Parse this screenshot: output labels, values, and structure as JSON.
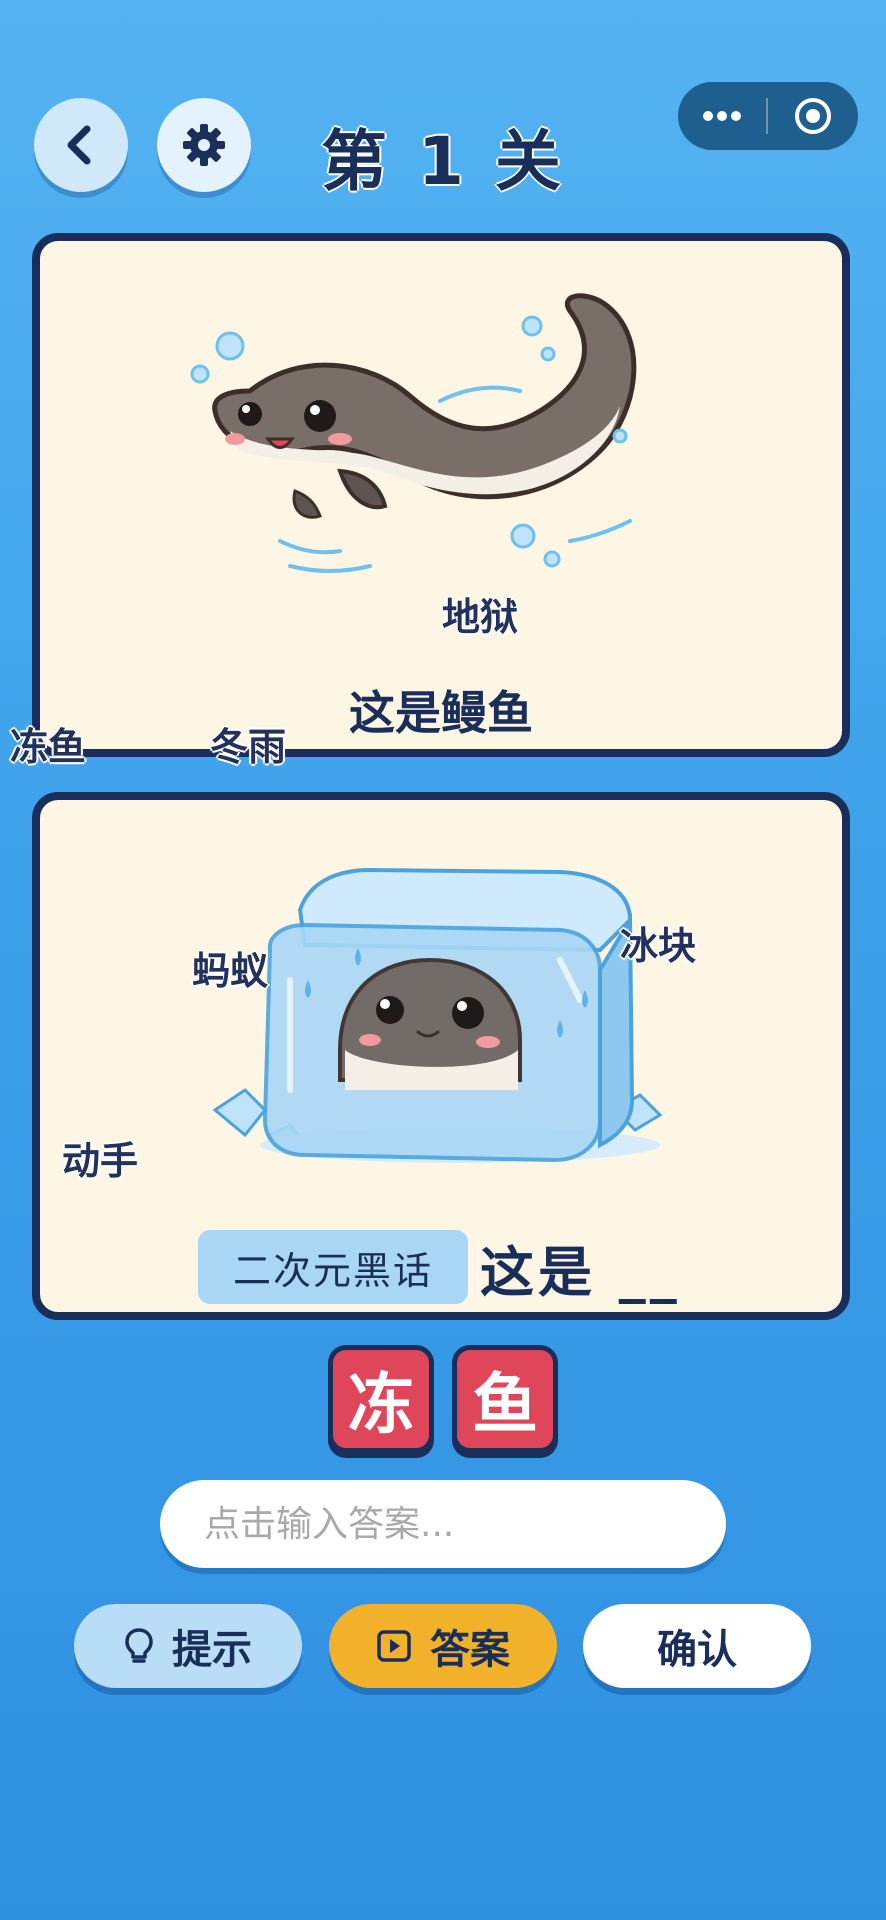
{
  "header": {
    "level_title": "第 1 关",
    "back_icon": "chevron-left-icon",
    "settings_icon": "gear-icon",
    "capsule_more_icon": "more-dots-icon",
    "capsule_close_icon": "target-circle-icon"
  },
  "panel_1": {
    "image_subject": "eel",
    "caption": "这是鳗鱼",
    "floating_words": [
      "地狱",
      "冻鱼",
      "冬雨"
    ]
  },
  "panel_2": {
    "image_subject": "eel frozen in ice cube",
    "floating_words": [
      "蚂蚁",
      "冰块",
      "动手"
    ],
    "tag": "二次元黑话",
    "caption": "这是 __"
  },
  "answer_tiles": [
    "冻",
    "鱼"
  ],
  "input": {
    "placeholder": "点击输入答案...",
    "value": ""
  },
  "buttons": {
    "hint_label": "提示",
    "hint_icon": "lightbulb-icon",
    "answer_label": "答案",
    "answer_icon": "video-play-icon",
    "confirm_label": "确认"
  },
  "colors": {
    "background": "#3da1ea",
    "panel_border": "#1a2e5a",
    "panel_bg": "#fdf6e4",
    "tile_red": "#e0465a",
    "answer_button": "#f2b12a",
    "hint_button": "#b9ddf7"
  }
}
